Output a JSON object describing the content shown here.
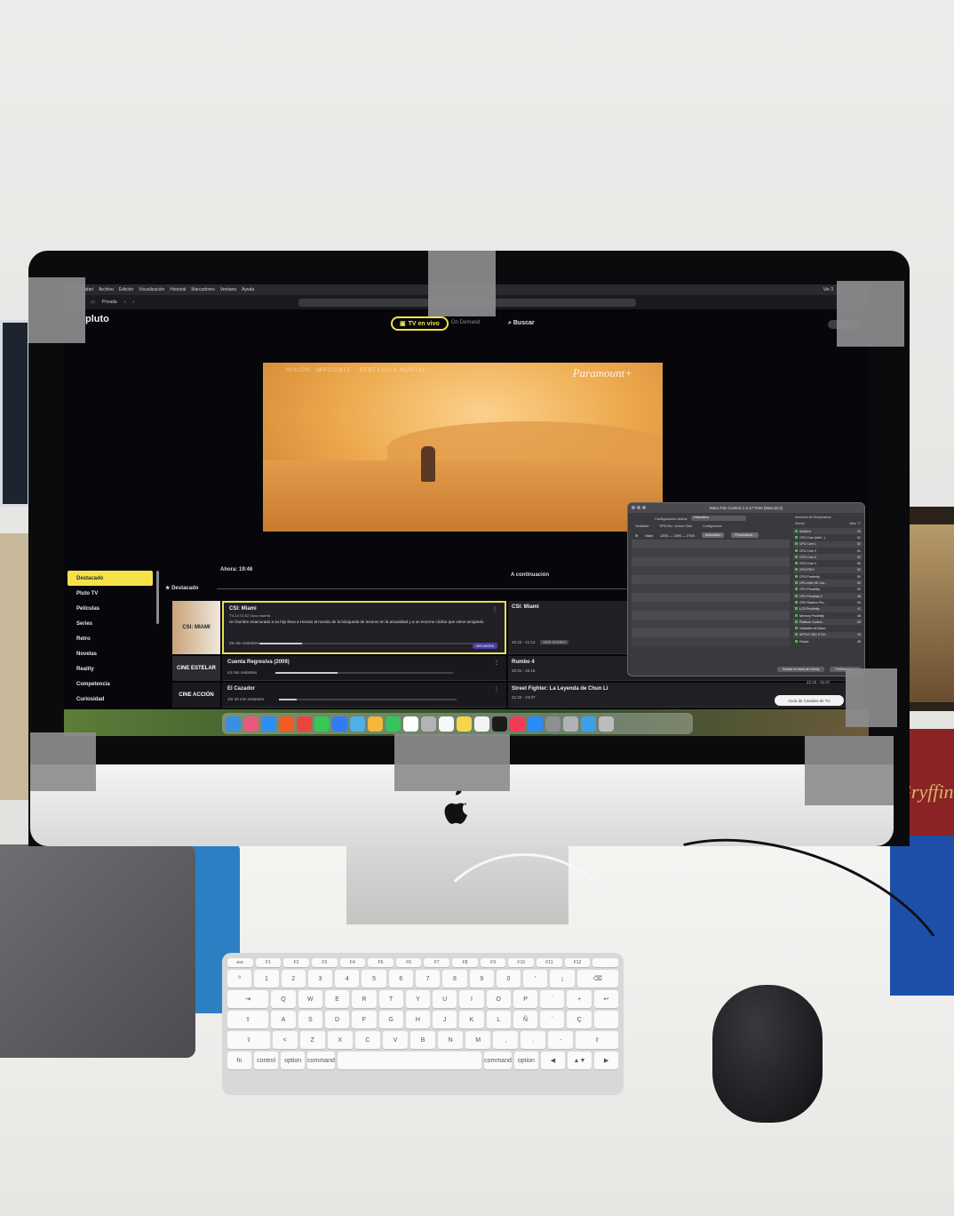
{
  "menubar": {
    "items": [
      "Safari",
      "Archivo",
      "Edición",
      "Visualización",
      "Historial",
      "Marcadores",
      "Ventana",
      "Ayuda"
    ],
    "status": "Vie 3"
  },
  "toolbar": {
    "mode_label": "Privada"
  },
  "pluto": {
    "logo": "pluto",
    "nav_live": "TV en vivo",
    "nav_on_demand": "On Demand",
    "nav_search": "Buscar"
  },
  "video": {
    "title": "MISIÓN: IMPOSIBLE - SENTENCIA MORTAL",
    "brand": "Paramount+"
  },
  "guide": {
    "now_label": "Ahora: 19:46",
    "next_label": "A continuación",
    "category_label": "Destacado",
    "sidebar": [
      "Destacado",
      "Pluto TV",
      "Películas",
      "Series",
      "Retro",
      "Novelas",
      "Reality",
      "Competencia",
      "Curiosidad"
    ],
    "rows": [
      {
        "channel": "CSI: MIAMI",
        "title": "CSI: Miami",
        "meta": "TV-14 T2 E2 Zona muerta",
        "description": "Un hombre enamorado a su hijo lleva a Horatio al mundo de la búsqueda de tesoros en la actualidad y a un enorme códice que viene arrojando.",
        "remaining": "25 min restantes",
        "progress": 0.2,
        "watch_label": "VER AHORA",
        "next_title": "CSI: Miami",
        "next_time": "20:22 - 21:12",
        "next_badge": "VER AHORA"
      },
      {
        "channel": "CINE ESTELAR",
        "title": "Cuenta Regresiva (2009)",
        "remaining": "44 min restantes",
        "progress": 0.35,
        "next_title": "Rumbo 4",
        "next_time": "20:31 - 22:15"
      },
      {
        "channel": "CINE ACCIÓN",
        "title": "El Cazador",
        "remaining": "1hr 46 min restantes",
        "progress": 0.1,
        "next_title": "Street Fighter: La Leyenda de Chun Li",
        "next_time": "21:33 - 23:07"
      }
    ],
    "tv_guide_button": "Guía de Canales de TV"
  },
  "fan_control": {
    "title": "Macs Fan Control 1.5.17 Free (iMac18,3)",
    "config_label": "Configuración activa:",
    "config_value": "Automática",
    "col_fan": "Ventilador",
    "col_rpm": "RPM Mín / Actual / Máx",
    "col_config": "Configuración",
    "fan_name": "Main",
    "fan_rpm": "1200 — 1199 — 2700",
    "fan_mode_auto": "Automático",
    "fan_mode_custom": "Personalizar...",
    "sensors_title": "Sensores de Temperatura:",
    "sensor_col": "Sensor",
    "value_col": "Valor °C",
    "sensors": [
      {
        "name": "Ambient",
        "value": "30"
      },
      {
        "name": "CPU Core (Intel...)",
        "value": "51"
      },
      {
        "name": "CPU Core 1",
        "value": "52"
      },
      {
        "name": "CPU Core 2",
        "value": "51"
      },
      {
        "name": "CPU Core 3",
        "value": "52"
      },
      {
        "name": "CPU Core 4",
        "value": "50"
      },
      {
        "name": "CPU PECI",
        "value": "52"
      },
      {
        "name": "CPU Proximity",
        "value": "50"
      },
      {
        "name": "GPU Intel HD Gra...",
        "value": "53"
      },
      {
        "name": "GPU Proximity",
        "value": "52"
      },
      {
        "name": "GPU Proximity 2",
        "value": "46"
      },
      {
        "name": "GPU Radeon Pro...",
        "value": "54"
      },
      {
        "name": "LCD Proximity",
        "value": "41"
      },
      {
        "name": "Memory Proximity",
        "value": "46"
      },
      {
        "name": "Platform Control...",
        "value": "53"
      },
      {
        "name": "Unidades de Disco",
        "value": ""
      },
      {
        "name": "APPLE HDD ST10...",
        "value": "44"
      },
      {
        "name": "Fusion",
        "value": "45"
      }
    ],
    "hide_button": "Ocultar en barra de menús",
    "prefs_button": "Preferencias...",
    "clock": "22:15 - 01:07"
  },
  "dock": {
    "apps": [
      "Finder",
      "Launchpad",
      "Safari",
      "Brave",
      "Chrome",
      "Messages",
      "Mail",
      "Maps",
      "Photos",
      "FaceTime",
      "Calendar",
      "Contacts",
      "Reminders",
      "Notes",
      "Freeform",
      "TV",
      "Music",
      "App Store",
      "Settings",
      "Disk Utility",
      "Downloads",
      "Trash"
    ],
    "colors": [
      "#3b8fe3",
      "#e65b7d",
      "#2d8ef5",
      "#f25a24",
      "#e9463a",
      "#36c759",
      "#2f7cf6",
      "#4fb0e8",
      "#f3b73b",
      "#35c45b",
      "#ffffff",
      "#b3b3b3",
      "#f7f7f7",
      "#f5d54a",
      "#f3f3f3",
      "#1b1b1b",
      "#f23c55",
      "#2a8cf5",
      "#8e8e93",
      "#b0b0b5",
      "#3aa0e8",
      "#bcbcc0"
    ]
  },
  "keyboard": {
    "rows": [
      [
        "esc",
        "F1",
        "F2",
        "F3",
        "F4",
        "F5",
        "F6",
        "F7",
        "F8",
        "F9",
        "F10",
        "F11",
        "F12",
        ""
      ],
      [
        "º",
        "1",
        "2",
        "3",
        "4",
        "5",
        "6",
        "7",
        "8",
        "9",
        "0",
        "'",
        "¡",
        "⌫"
      ],
      [
        "⇥",
        "Q",
        "W",
        "E",
        "R",
        "T",
        "Y",
        "U",
        "I",
        "O",
        "P",
        "`",
        "+",
        "↩"
      ],
      [
        "⇪",
        "A",
        "S",
        "D",
        "F",
        "G",
        "H",
        "J",
        "K",
        "L",
        "Ñ",
        "´",
        "Ç",
        ""
      ],
      [
        "⇧",
        "<",
        "Z",
        "X",
        "C",
        "V",
        "B",
        "N",
        "M",
        ",",
        ".",
        "-",
        "⇧"
      ],
      [
        "fn",
        "control",
        "option",
        "command",
        "",
        "command",
        "option",
        "◀",
        "▲▼",
        "▶"
      ]
    ]
  },
  "colors": {
    "pluto_yellow": "#f5e24b",
    "screen_bg": "#07070b",
    "desk": "#f4f4f2"
  }
}
